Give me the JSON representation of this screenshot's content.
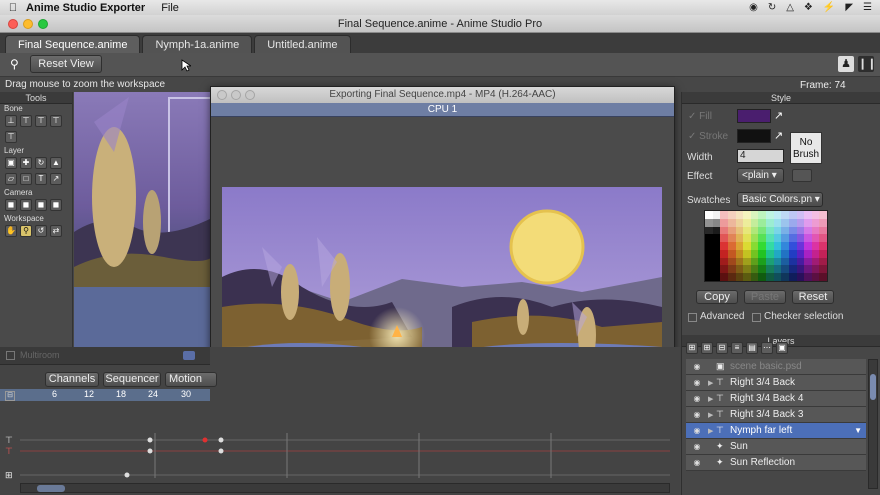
{
  "menubar": {
    "app_name": "Anime Studio Exporter",
    "menu_file": "File",
    "status_icons": [
      "creative-cloud-icon",
      "sync-icon",
      "drive-icon",
      "dropbox-icon",
      "bolt-icon",
      "wifi-icon",
      "list-icon"
    ]
  },
  "window": {
    "title": "Final Sequence.anime - Anime Studio Pro"
  },
  "tabs": [
    {
      "label": "Final Sequence.anime"
    },
    {
      "label": "Nymph-1a.anime"
    },
    {
      "label": "Untitled.anime"
    }
  ],
  "toolbar": {
    "reset_view_label": "Reset View",
    "frame_label": "Frame: 74"
  },
  "hint": "Drag mouse to zoom the workspace",
  "tools": {
    "title": "Tools",
    "sections": [
      "Bone",
      "Layer",
      "Camera",
      "Workspace"
    ]
  },
  "export_window": {
    "title": "Exporting Final Sequence.mp4 - MP4 (H.264-AAC)",
    "cpu_label": "CPU 1"
  },
  "timeline": {
    "tabs": [
      "Channels",
      "Sequencer",
      "Motion Gr"
    ],
    "ruler": [
      "6",
      "12",
      "18",
      "24",
      "30"
    ],
    "panel_label": "Multiroom"
  },
  "style_panel": {
    "title": "Style",
    "fill_label": "Fill",
    "stroke_label": "Stroke",
    "fill_color": "#4a1e6e",
    "stroke_color": "#111111",
    "no_brush_label": "No\nBrush",
    "width_label": "Width",
    "width_value": "4",
    "effect_label": "Effect",
    "effect_value": "<plain",
    "swatches_label": "Swatches",
    "swatches_value": "Basic Colors.pn",
    "copy_label": "Copy",
    "paste_label": "Paste",
    "reset_label": "Reset",
    "advanced_label": "Advanced",
    "checker_label": "Checker selection"
  },
  "layers_panel": {
    "title": "Layers",
    "items": [
      {
        "name": "scene basic.psd",
        "selected": false,
        "icon": "image-icon"
      },
      {
        "name": "Right 3/4 Back",
        "selected": false,
        "icon": "bone-icon"
      },
      {
        "name": "Right 3/4 Back 4",
        "selected": false,
        "icon": "bone-icon"
      },
      {
        "name": "Right 3/4 Back 3",
        "selected": false,
        "icon": "bone-icon"
      },
      {
        "name": "Nymph far left",
        "selected": true,
        "icon": "bone-icon"
      },
      {
        "name": "Sun",
        "selected": false,
        "icon": "vector-icon"
      },
      {
        "name": "Sun Reflection",
        "selected": false,
        "icon": "vector-icon"
      }
    ]
  }
}
